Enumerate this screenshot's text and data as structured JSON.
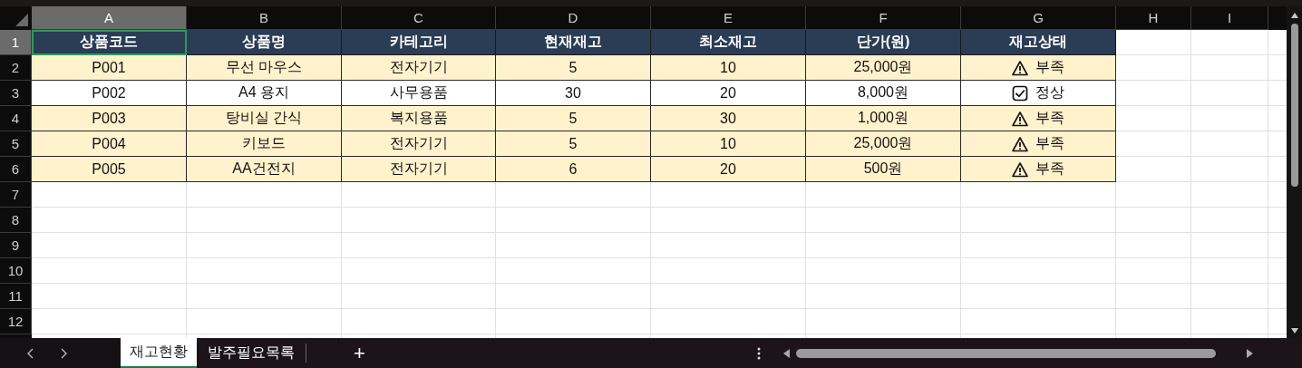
{
  "column_headers": [
    {
      "label": "A",
      "selected": true
    },
    {
      "label": "B",
      "selected": false
    },
    {
      "label": "C",
      "selected": false
    },
    {
      "label": "D",
      "selected": false
    },
    {
      "label": "E",
      "selected": false
    },
    {
      "label": "F",
      "selected": false
    },
    {
      "label": "G",
      "selected": false
    },
    {
      "label": "H",
      "selected": false
    },
    {
      "label": "I",
      "selected": false
    }
  ],
  "row_headers": [
    {
      "label": "1",
      "selected": true
    },
    {
      "label": "2",
      "selected": false
    },
    {
      "label": "3",
      "selected": false
    },
    {
      "label": "4",
      "selected": false
    },
    {
      "label": "5",
      "selected": false
    },
    {
      "label": "6",
      "selected": false
    },
    {
      "label": "7",
      "selected": false
    },
    {
      "label": "8",
      "selected": false
    },
    {
      "label": "9",
      "selected": false
    },
    {
      "label": "10",
      "selected": false
    },
    {
      "label": "11",
      "selected": false
    },
    {
      "label": "12",
      "selected": false
    }
  ],
  "table": {
    "columns": [
      "상품코드",
      "상품명",
      "카테고리",
      "현재재고",
      "최소재고",
      "단가(원)",
      "재고상태"
    ],
    "rows": [
      {
        "highlighted": true,
        "cells": [
          "P001",
          "무선 마우스",
          "전자기기",
          "5",
          "10",
          "25,000원"
        ],
        "status": {
          "kind": "warning",
          "text": "부족"
        }
      },
      {
        "highlighted": false,
        "cells": [
          "P002",
          "A4 용지",
          "사무용품",
          "30",
          "20",
          "8,000원"
        ],
        "status": {
          "kind": "ok",
          "text": "정상"
        }
      },
      {
        "highlighted": true,
        "cells": [
          "P003",
          "탕비실 간식",
          "복지용품",
          "5",
          "30",
          "1,000원"
        ],
        "status": {
          "kind": "warning",
          "text": "부족"
        }
      },
      {
        "highlighted": true,
        "cells": [
          "P004",
          "키보드",
          "전자기기",
          "5",
          "10",
          "25,000원"
        ],
        "status": {
          "kind": "warning",
          "text": "부족"
        }
      },
      {
        "highlighted": true,
        "cells": [
          "P005",
          "AA건전지",
          "전자기기",
          "6",
          "20",
          "500원"
        ],
        "status": {
          "kind": "warning",
          "text": "부족"
        }
      }
    ]
  },
  "sheet_tabs": [
    {
      "label": "재고현황",
      "selected": true
    },
    {
      "label": "발주필요목록",
      "selected": false
    }
  ],
  "add_sheet": "+"
}
